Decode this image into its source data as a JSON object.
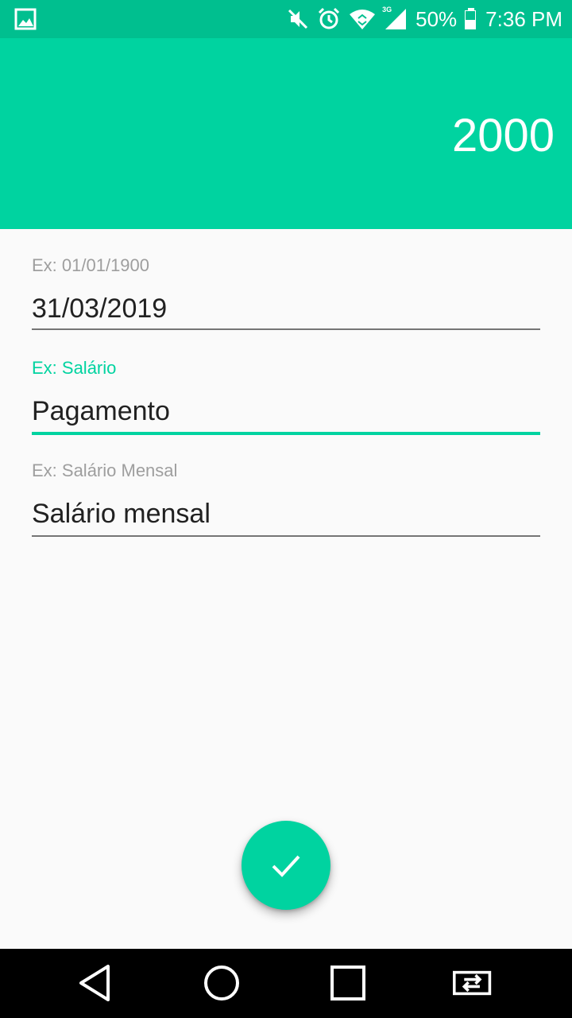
{
  "status_bar": {
    "battery_percent": "50%",
    "time": "7:36 PM",
    "network_type": "3G",
    "icons": [
      "image-notification-icon",
      "mute-icon",
      "alarm-icon",
      "wifi-icon",
      "cell-signal-icon",
      "battery-icon"
    ]
  },
  "header": {
    "amount": "2000"
  },
  "form": {
    "fields": [
      {
        "hint": "Ex: 01/01/1900",
        "value": "31/03/2019"
      },
      {
        "hint": "Ex: Salário",
        "value": "Pagamento"
      },
      {
        "hint": "Ex: Salário Mensal",
        "value": "Salário mensal"
      }
    ]
  },
  "fab": {
    "icon": "check-icon"
  },
  "nav_bar": {
    "icons": [
      "back-icon",
      "home-icon",
      "recents-icon",
      "switch-apps-icon"
    ]
  },
  "colors": {
    "status_bar": "#00bf8f",
    "accent": "#00d3a0",
    "background": "#fafafa",
    "text": "#212121",
    "hint": "#9e9e9e"
  }
}
